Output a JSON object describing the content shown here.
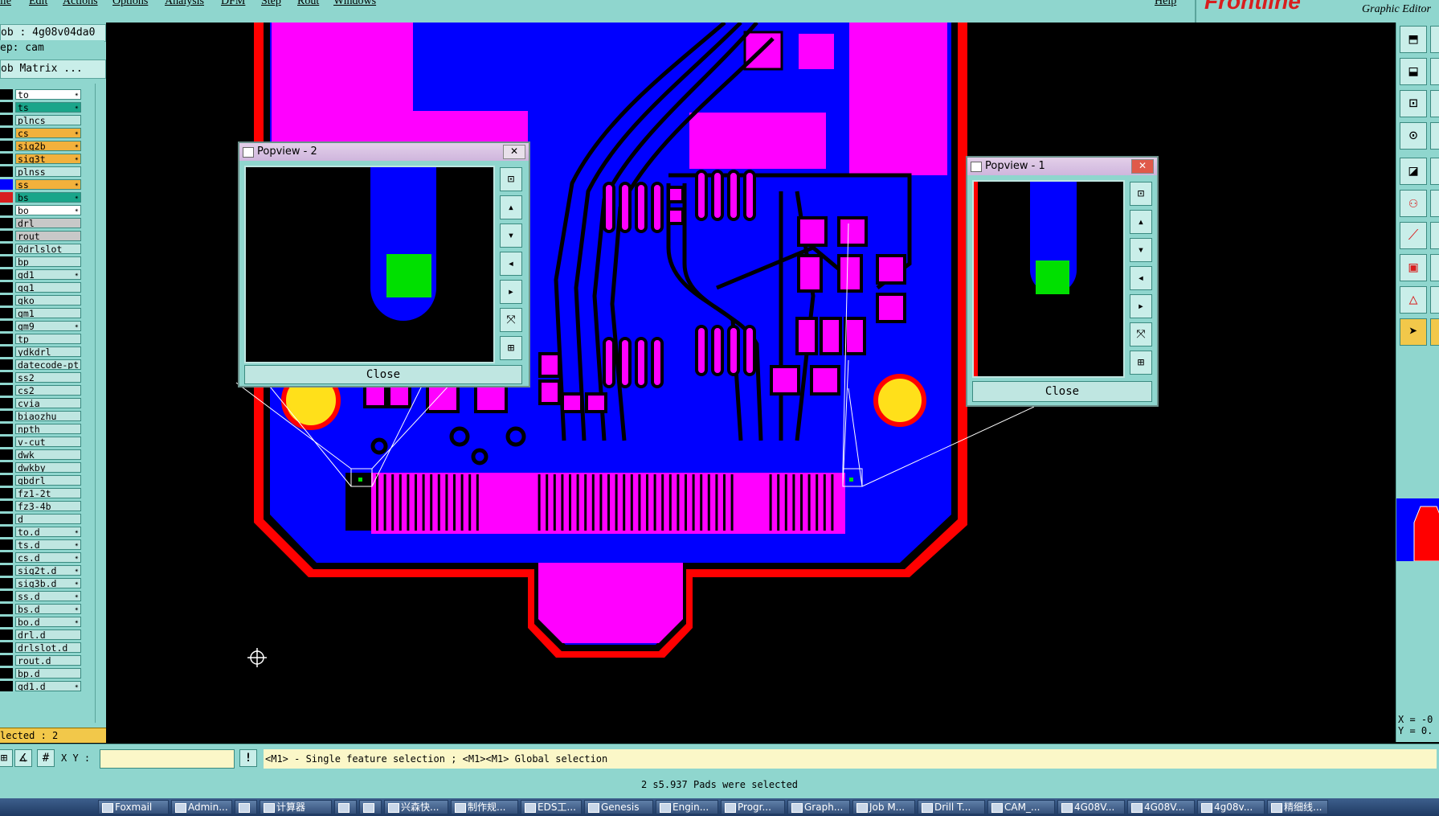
{
  "menu": [
    "ile",
    "Edit",
    "Actions",
    "Options",
    "Analysis",
    "DFM",
    "Step",
    "Rout",
    "Windows"
  ],
  "help_label": "Help",
  "brand": {
    "logo": "Frontline",
    "subtitle": "Graphic Editor"
  },
  "left_panel": {
    "job": "ob : 4g08v04da0",
    "step": "ep: cam",
    "matrix_button": "ob Matrix ...",
    "layers": [
      {
        "name": "to",
        "color": "#ffffff",
        "mark": "✴"
      },
      {
        "name": "ts",
        "color": "#1aa58a",
        "mark": "✴"
      },
      {
        "name": "plncs",
        "color": "#bfe6e1",
        "mark": ""
      },
      {
        "name": "cs",
        "color": "#f2b13c",
        "mark": "✴"
      },
      {
        "name": "sig2b",
        "color": "#f2b13c",
        "mark": "✴"
      },
      {
        "name": "sig3t",
        "color": "#f2b13c",
        "mark": "✴"
      },
      {
        "name": "plnss",
        "color": "#bfe6e1",
        "mark": ""
      },
      {
        "name": "ss",
        "color": "#f2b13c",
        "mark": "✴"
      },
      {
        "name": "bs",
        "color": "#1aa58a",
        "mark": "✴"
      },
      {
        "name": "bo",
        "color": "#ffffff",
        "mark": "✴"
      },
      {
        "name": "drl",
        "color": "#c8c8c8",
        "mark": ""
      },
      {
        "name": "rout",
        "color": "#c8c8c8",
        "mark": ""
      },
      {
        "name": "0drlslot",
        "color": "#bfe6e1",
        "mark": ""
      },
      {
        "name": "bp",
        "color": "#bfe6e1",
        "mark": ""
      },
      {
        "name": "gd1",
        "color": "#bfe6e1",
        "mark": "✴"
      },
      {
        "name": "gg1",
        "color": "#bfe6e1",
        "mark": ""
      },
      {
        "name": "gko",
        "color": "#bfe6e1",
        "mark": ""
      },
      {
        "name": "gm1",
        "color": "#bfe6e1",
        "mark": ""
      },
      {
        "name": "gm9",
        "color": "#bfe6e1",
        "mark": "✴"
      },
      {
        "name": "tp",
        "color": "#bfe6e1",
        "mark": ""
      },
      {
        "name": "ydkdrl",
        "color": "#bfe6e1",
        "mark": ""
      },
      {
        "name": "datecode-pt",
        "color": "#bfe6e1",
        "mark": ""
      },
      {
        "name": "ss2",
        "color": "#bfe6e1",
        "mark": ""
      },
      {
        "name": "cs2",
        "color": "#bfe6e1",
        "mark": ""
      },
      {
        "name": "cvia",
        "color": "#bfe6e1",
        "mark": ""
      },
      {
        "name": "biaozhu",
        "color": "#bfe6e1",
        "mark": ""
      },
      {
        "name": "npth",
        "color": "#bfe6e1",
        "mark": ""
      },
      {
        "name": "v-cut",
        "color": "#bfe6e1",
        "mark": ""
      },
      {
        "name": "dwk",
        "color": "#bfe6e1",
        "mark": ""
      },
      {
        "name": "dwkby",
        "color": "#bfe6e1",
        "mark": ""
      },
      {
        "name": "gbdrl",
        "color": "#bfe6e1",
        "mark": ""
      },
      {
        "name": "fz1-2t",
        "color": "#bfe6e1",
        "mark": ""
      },
      {
        "name": "fz3-4b",
        "color": "#bfe6e1",
        "mark": ""
      },
      {
        "name": "d",
        "color": "#bfe6e1",
        "mark": ""
      },
      {
        "name": "to.d",
        "color": "#bfe6e1",
        "mark": "✴"
      },
      {
        "name": "ts.d",
        "color": "#bfe6e1",
        "mark": "✴"
      },
      {
        "name": "cs.d",
        "color": "#bfe6e1",
        "mark": "✴"
      },
      {
        "name": "sig2t.d",
        "color": "#bfe6e1",
        "mark": "✴"
      },
      {
        "name": "sig3b.d",
        "color": "#bfe6e1",
        "mark": "✴"
      },
      {
        "name": "ss.d",
        "color": "#bfe6e1",
        "mark": "✴"
      },
      {
        "name": "bs.d",
        "color": "#bfe6e1",
        "mark": "✴"
      },
      {
        "name": "bo.d",
        "color": "#bfe6e1",
        "mark": "✴"
      },
      {
        "name": "drl.d",
        "color": "#bfe6e1",
        "mark": ""
      },
      {
        "name": "drlslot.d",
        "color": "#bfe6e1",
        "mark": ""
      },
      {
        "name": "rout.d",
        "color": "#bfe6e1",
        "mark": ""
      },
      {
        "name": "bp.d",
        "color": "#bfe6e1",
        "mark": ""
      },
      {
        "name": "gd1.d",
        "color": "#bfe6e1",
        "mark": "✴"
      }
    ],
    "selected_count": "lected : 2"
  },
  "command_bar": {
    "xy_label": "X Y :",
    "xy_value": "",
    "hint": "<M1> - Single feature selection ; <M1><M1> Global selection"
  },
  "message": "2 s5.937 Pads were selected",
  "coords": {
    "x": "X = -0",
    "y": "Y = 0."
  },
  "popview2": {
    "title": "Popview - 2",
    "close_label": "Close"
  },
  "popview1": {
    "title": "Popview - 1",
    "close_label": "Close"
  },
  "taskbar": [
    "Foxmail",
    "Admin...",
    "",
    "计算器",
    "",
    "",
    "兴森快...",
    "制作规...",
    "EDS工...",
    "Genesis",
    "Engin...",
    "Progr...",
    "Graph...",
    "Job M...",
    "Drill T...",
    "CAM_...",
    "4G08V...",
    "4G08V...",
    "4g08v...",
    "精细线..."
  ],
  "colors": {
    "panel": "#8fd6ce",
    "copper": "#0000ff",
    "pad": "#ff00ff",
    "outline": "#ff0000",
    "hole": "#ffe01a",
    "selected": "#00e000"
  }
}
